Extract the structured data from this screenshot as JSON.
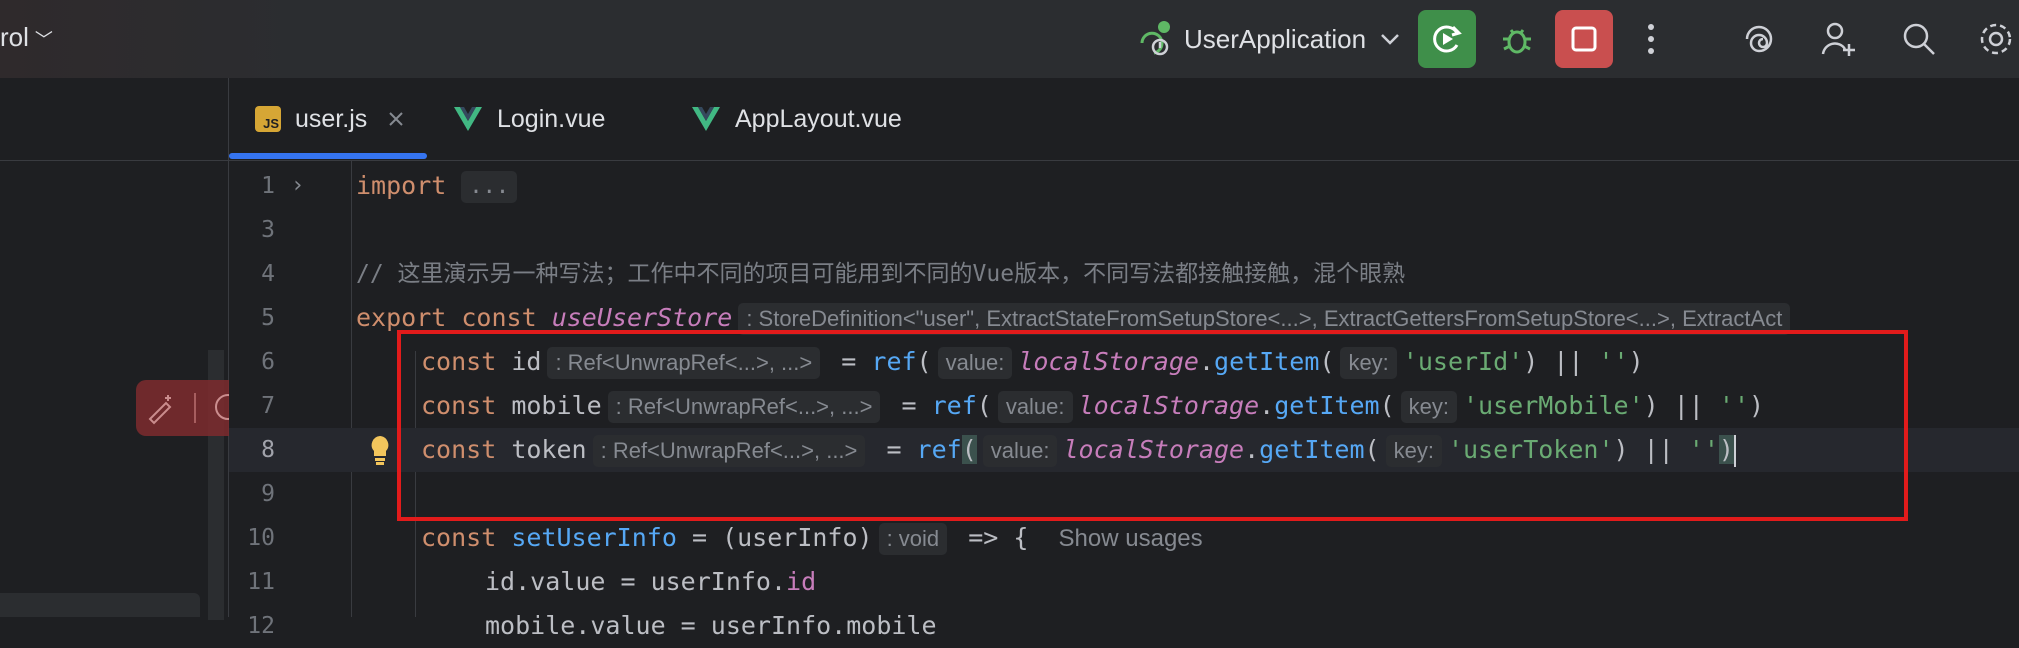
{
  "toolbar": {
    "vcs_label": "rol",
    "run_config": "UserApplication",
    "accent_run": "#3f8f4a",
    "accent_stop": "#c94f4f"
  },
  "tabs": [
    {
      "label": "user.js",
      "icon": "js-file-icon",
      "active": true
    },
    {
      "label": "Login.vue",
      "icon": "vue-file-icon",
      "active": false
    },
    {
      "label": "AppLayout.vue",
      "icon": "vue-file-icon",
      "active": false
    }
  ],
  "editor": {
    "lines": [
      {
        "n": "1"
      },
      {
        "n": "3"
      },
      {
        "n": "4"
      },
      {
        "n": "5"
      },
      {
        "n": "6"
      },
      {
        "n": "7"
      },
      {
        "n": "8"
      },
      {
        "n": "9"
      },
      {
        "n": "10"
      },
      {
        "n": "11"
      },
      {
        "n": "12"
      }
    ],
    "l1_import": "import",
    "l1_folded": "...",
    "l4_comment": "// 这里演示另一种写法；工作中不同的项目可能用到不同的Vue版本，不同写法都接触接触，混个眼熟",
    "l5_export": "export const",
    "l5_name": "useUserStore",
    "l5_hint": ": StoreDefinition<\"user\", ExtractStateFromSetupStore<...>, ExtractGettersFromSetupStore<...>, ExtractAct",
    "ref_hint": ": Ref<UnwrapRef<...>, ...>",
    "value_hint": "value:",
    "key_hint": "key:",
    "l6_var": "id",
    "l6_key": "'userId'",
    "l7_var": "mobile",
    "l7_key": "'userMobile'",
    "l8_var": "token",
    "l8_key": "'userToken'",
    "empty_str": "''",
    "const_kw": "const",
    "ref_fn": "ref",
    "storage": "localStorage",
    "getitem": "getItem",
    "l10_name": "setUserInfo",
    "l10_param": "(userInfo)",
    "l10_hint": ": void",
    "l10_arrow": " => {",
    "l10_usages": "Show usages",
    "l11_code_a": "id",
    "l11_code_b": ".value = userInfo.",
    "l11_code_c": "id",
    "l12_partial": "mobile.value = userInfo.mobile"
  }
}
